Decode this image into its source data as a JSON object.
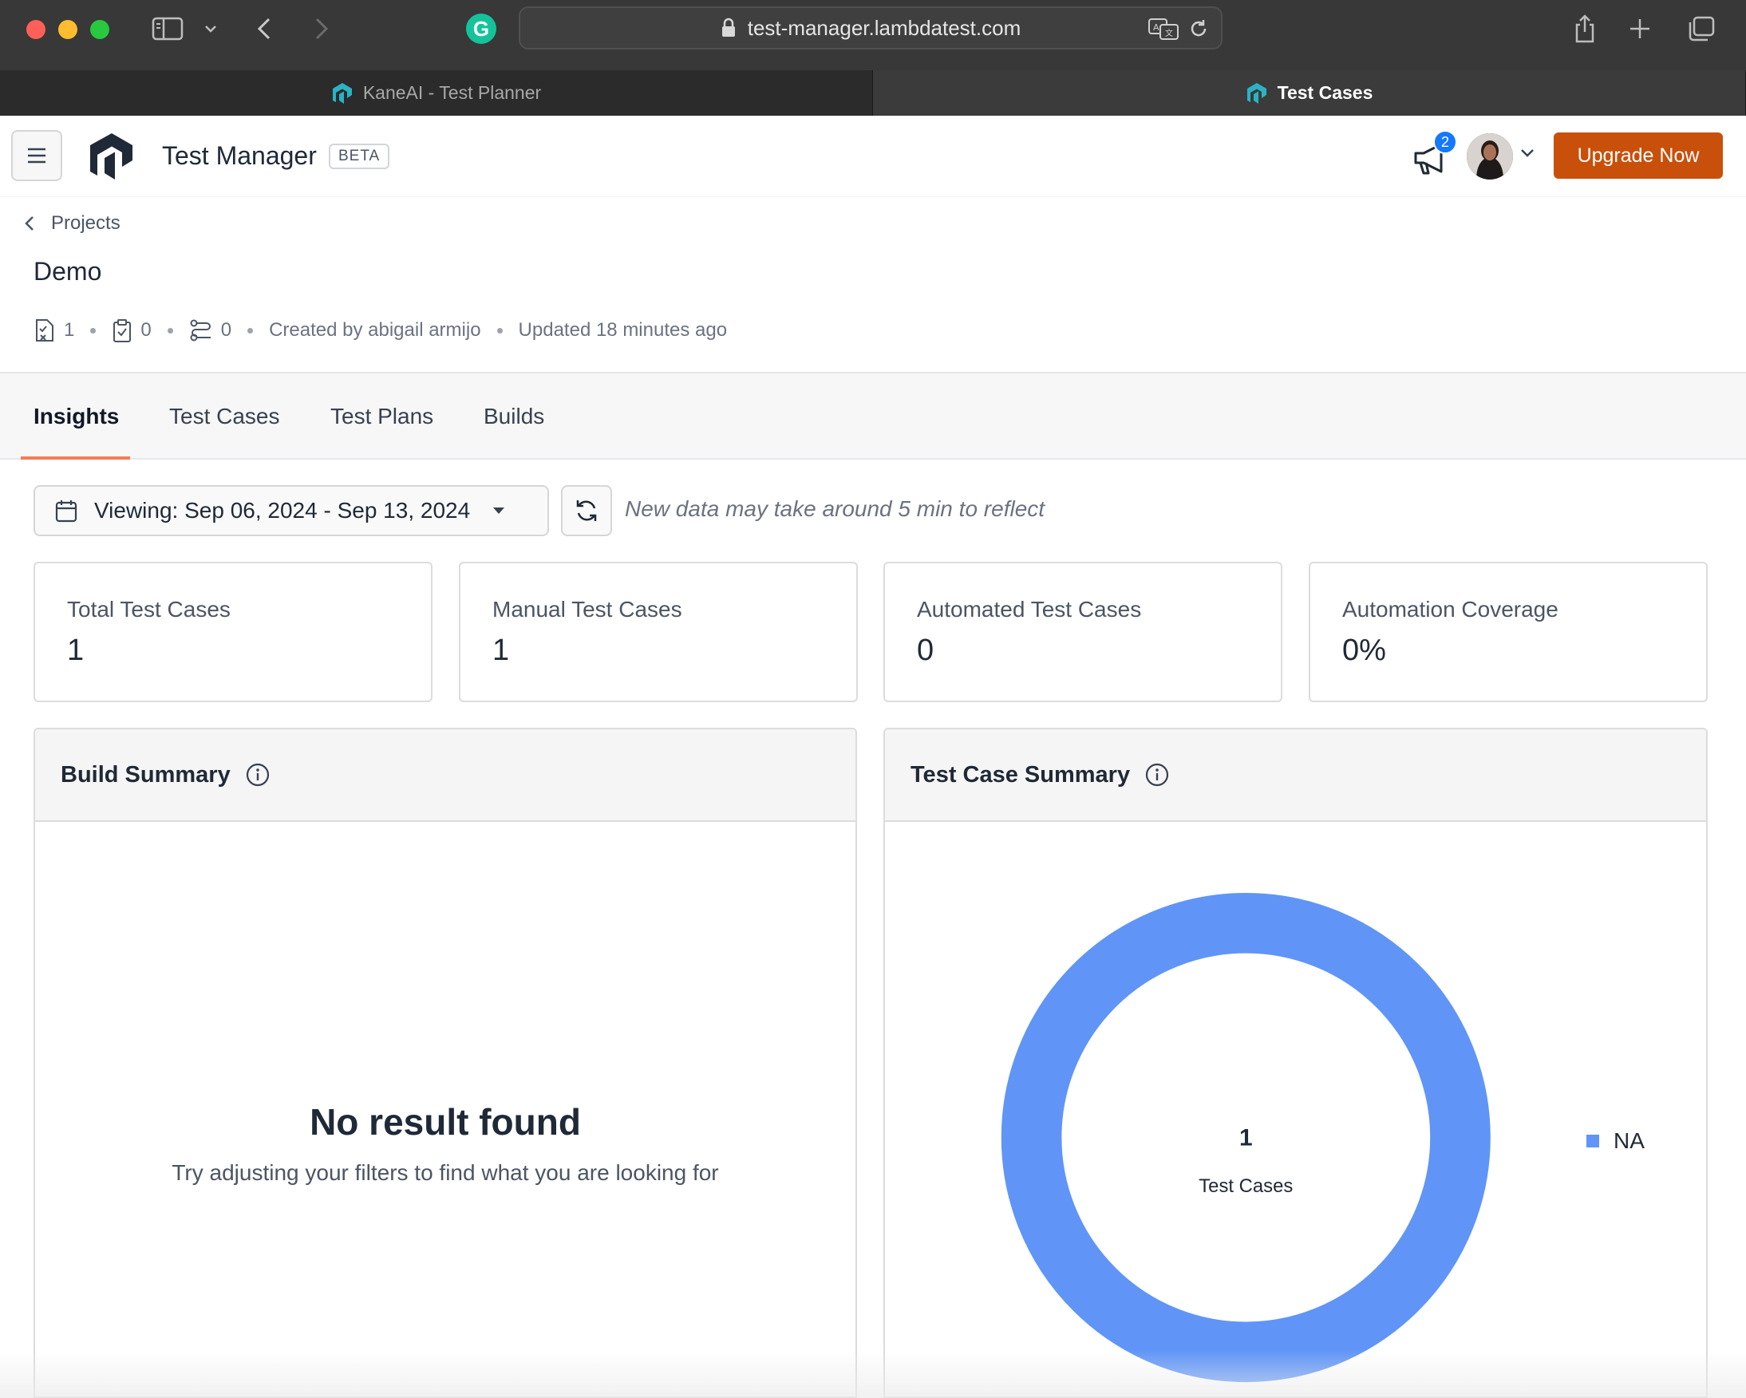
{
  "browser": {
    "url": "test-manager.lambdatest.com",
    "tabs": [
      {
        "label": "KaneAI - Test Planner",
        "active": false
      },
      {
        "label": "Test Cases",
        "active": true
      }
    ]
  },
  "header": {
    "app_title": "Test Manager",
    "beta_label": "BETA",
    "notification_count": "2",
    "upgrade_label": "Upgrade Now"
  },
  "project": {
    "breadcrumb": "Projects",
    "title": "Demo",
    "test_case_count": "1",
    "test_plan_count": "0",
    "build_count": "0",
    "created_by": "Created by abigail armijo",
    "updated": "Updated 18 minutes ago"
  },
  "tabs": [
    {
      "label": "Insights",
      "active": true
    },
    {
      "label": "Test Cases",
      "active": false
    },
    {
      "label": "Test Plans",
      "active": false
    },
    {
      "label": "Builds",
      "active": false
    }
  ],
  "filters": {
    "date_range": "Viewing: Sep 06, 2024 - Sep 13, 2024",
    "note": "New data may take around 5 min to reflect"
  },
  "stats": [
    {
      "label": "Total Test Cases",
      "value": "1"
    },
    {
      "label": "Manual Test Cases",
      "value": "1"
    },
    {
      "label": "Automated Test Cases",
      "value": "0"
    },
    {
      "label": "Automation Coverage",
      "value": "0%"
    }
  ],
  "build_summary": {
    "title": "Build Summary",
    "empty_title": "No result found",
    "empty_subtitle": "Try adjusting your filters to find what you are looking for"
  },
  "test_case_summary": {
    "title": "Test Case Summary",
    "center_value": "1",
    "center_label": "Test Cases"
  },
  "colors": {
    "accent": "#c8500b",
    "tab_underline": "#f47c54",
    "donut": "#6095f7",
    "badge": "#1677ff"
  },
  "chart_data": {
    "type": "pie",
    "categories": [
      "NA"
    ],
    "values": [
      1
    ],
    "colors": [
      "#6095f7"
    ],
    "legend": "right"
  }
}
